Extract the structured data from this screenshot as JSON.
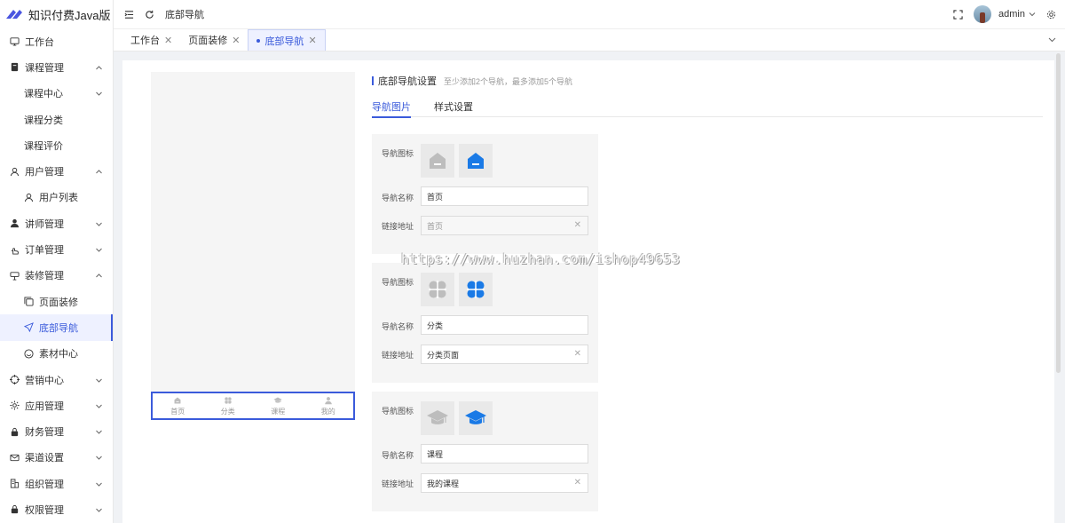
{
  "app": {
    "title": "知识付费Java版"
  },
  "sidebar": {
    "items": [
      {
        "label": "工作台",
        "icon": "monitor-icon",
        "level": 1,
        "arrow": ""
      },
      {
        "label": "课程管理",
        "icon": "book-icon",
        "level": 1,
        "arrow": "up"
      },
      {
        "label": "课程中心",
        "icon": "",
        "level": 2,
        "arrow": "down"
      },
      {
        "label": "课程分类",
        "icon": "",
        "level": 2,
        "arrow": ""
      },
      {
        "label": "课程评价",
        "icon": "",
        "level": 2,
        "arrow": ""
      },
      {
        "label": "用户管理",
        "icon": "user-icon",
        "level": 1,
        "arrow": "up"
      },
      {
        "label": "用户列表",
        "icon": "user-icon",
        "level": 2,
        "arrow": ""
      },
      {
        "label": "讲师管理",
        "icon": "teacher-icon",
        "level": 1,
        "arrow": "down"
      },
      {
        "label": "订单管理",
        "icon": "hand-icon",
        "level": 1,
        "arrow": "down"
      },
      {
        "label": "装修管理",
        "icon": "decor-icon",
        "level": 1,
        "arrow": "up"
      },
      {
        "label": "页面装修",
        "icon": "copy-icon",
        "level": 2,
        "arrow": ""
      },
      {
        "label": "底部导航",
        "icon": "send-icon",
        "level": 2,
        "arrow": "",
        "active": true
      },
      {
        "label": "素材中心",
        "icon": "smile-icon",
        "level": 2,
        "arrow": ""
      },
      {
        "label": "营销中心",
        "icon": "target-icon",
        "level": 1,
        "arrow": "down"
      },
      {
        "label": "应用管理",
        "icon": "sun-icon",
        "level": 1,
        "arrow": "down"
      },
      {
        "label": "财务管理",
        "icon": "lock-icon",
        "level": 1,
        "arrow": "down"
      },
      {
        "label": "渠道设置",
        "icon": "mail-icon",
        "level": 1,
        "arrow": "down"
      },
      {
        "label": "组织管理",
        "icon": "org-icon",
        "level": 1,
        "arrow": "down"
      },
      {
        "label": "权限管理",
        "icon": "lock-icon",
        "level": 1,
        "arrow": "down"
      }
    ]
  },
  "topbar": {
    "breadcrumb": "底部导航",
    "user": "admin"
  },
  "tabs": [
    {
      "label": "工作台",
      "active": false
    },
    {
      "label": "页面装修",
      "active": false
    },
    {
      "label": "底部导航",
      "active": true
    }
  ],
  "preview": {
    "nav_items": [
      {
        "label": "首页",
        "icon": "home-icon"
      },
      {
        "label": "分类",
        "icon": "grid-icon"
      },
      {
        "label": "课程",
        "icon": "cap-icon"
      },
      {
        "label": "我的",
        "icon": "person-icon"
      }
    ]
  },
  "settings": {
    "title": "底部导航设置",
    "tip": "至少添加2个导航，最多添加5个导航",
    "subtabs": [
      "导航图片",
      "样式设置"
    ],
    "active_subtab": 0,
    "label_icon": "导航图标",
    "label_name": "导航名称",
    "label_link": "链接地址",
    "cards": [
      {
        "icon": "home-icon",
        "name": "首页",
        "link": "首页",
        "link_disabled": true
      },
      {
        "icon": "grid-icon",
        "name": "分类",
        "link": "分类页面",
        "link_disabled": false
      },
      {
        "icon": "cap-icon",
        "name": "课程",
        "link": "我的课程",
        "link_disabled": false
      }
    ]
  },
  "colors": {
    "accent": "#3b5bdb",
    "icon_active": "#1a7ae6",
    "icon_inactive": "#bdbdbd"
  },
  "watermark": "https://www.huzhan.com/ishop49653"
}
